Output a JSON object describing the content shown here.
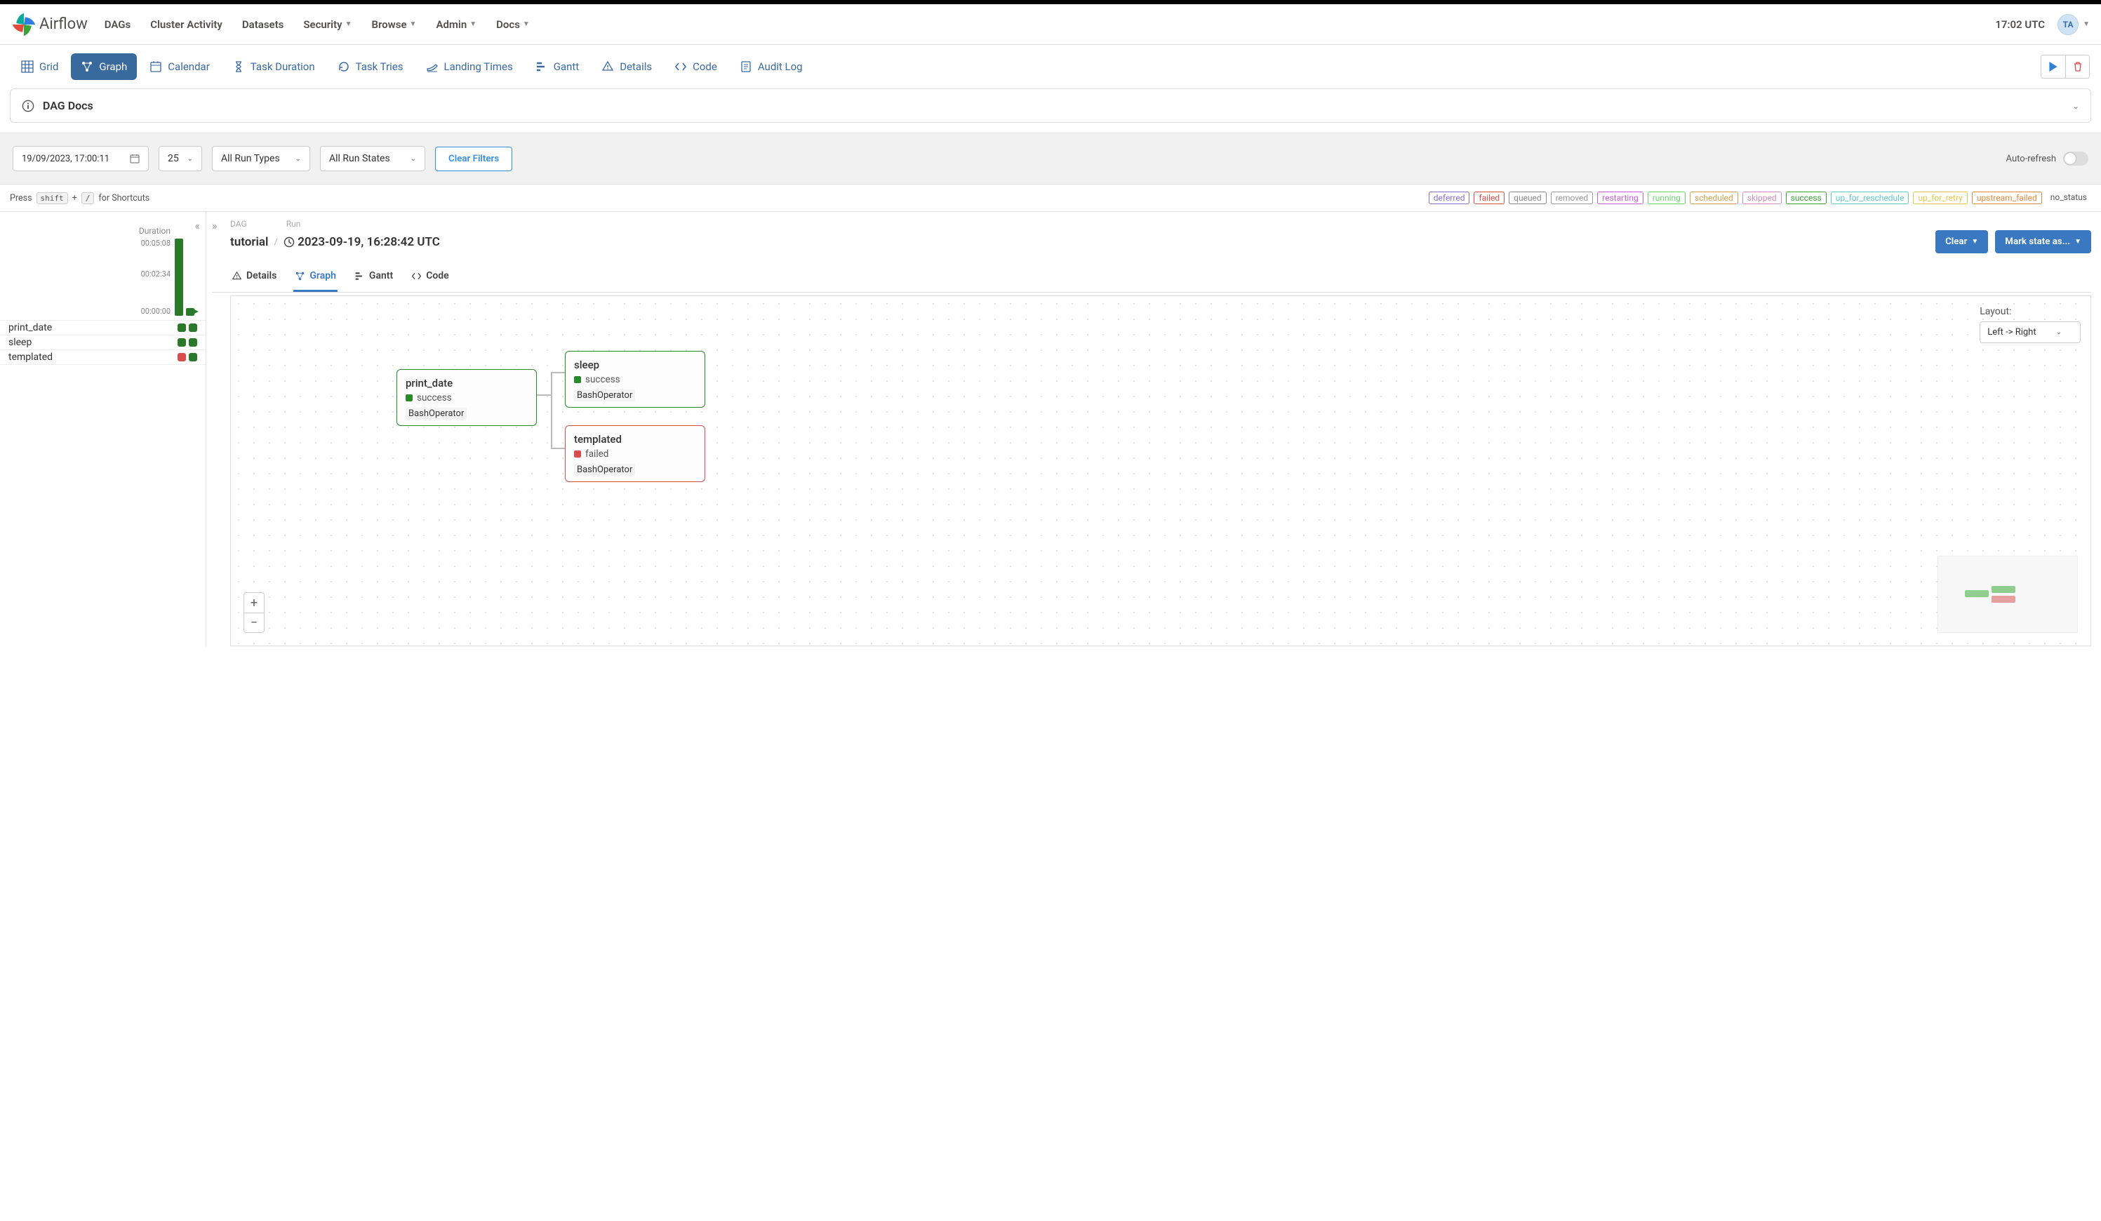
{
  "brand": "Airflow",
  "nav": {
    "items": [
      "DAGs",
      "Cluster Activity",
      "Datasets",
      "Security",
      "Browse",
      "Admin",
      "Docs"
    ],
    "dropdown_flags": [
      false,
      false,
      false,
      true,
      true,
      true,
      true
    ],
    "clock": "17:02 UTC",
    "avatar": "TA"
  },
  "view_tabs": {
    "items": [
      "Grid",
      "Graph",
      "Calendar",
      "Task Duration",
      "Task Tries",
      "Landing Times",
      "Gantt",
      "Details",
      "Code",
      "Audit Log"
    ],
    "active_index": 1
  },
  "dag_docs_label": "DAG Docs",
  "filters": {
    "date": "19/09/2023, 17:00:11",
    "page_size": "25",
    "run_type": "All Run Types",
    "run_state": "All Run States",
    "clear_btn": "Clear Filters",
    "auto_refresh": "Auto-refresh"
  },
  "hint": {
    "press": "Press",
    "shift": "shift",
    "plus": "+",
    "slash": "/",
    "for": "for Shortcuts"
  },
  "status_legend": [
    "deferred",
    "failed",
    "queued",
    "removed",
    "restarting",
    "running",
    "scheduled",
    "skipped",
    "success",
    "up_for_reschedule",
    "up_for_retry",
    "upstream_failed",
    "no_status"
  ],
  "status_colors": {
    "deferred": "#8b6fd0",
    "failed": "#d94d4d",
    "queued": "#888",
    "removed": "#999",
    "restarting": "#c65edb",
    "running": "#6bd46b",
    "scheduled": "#cfa24a",
    "skipped": "#d38bc1",
    "success": "#3aa33a",
    "up_for_reschedule": "#5fc9c6",
    "up_for_retry": "#e0c84b",
    "upstream_failed": "#e08a3c",
    "no_status": "#777"
  },
  "left": {
    "duration_label": "Duration",
    "ticks": [
      "00:05:08",
      "00:02:34",
      "00:00:00"
    ],
    "tasks": [
      {
        "name": "print_date",
        "boxes": [
          "green",
          "green"
        ]
      },
      {
        "name": "sleep",
        "boxes": [
          "green",
          "green"
        ]
      },
      {
        "name": "templated",
        "boxes": [
          "red",
          "green"
        ]
      }
    ]
  },
  "crumb": {
    "dag_h": "DAG",
    "run_h": "Run",
    "dag": "tutorial",
    "run": "2023-09-19, 16:28:42 UTC",
    "btn_clear": "Clear",
    "btn_mark": "Mark state as..."
  },
  "inner_tabs": {
    "items": [
      "Details",
      "Graph",
      "Gantt",
      "Code"
    ],
    "active_index": 1
  },
  "layout": {
    "label": "Layout:",
    "value": "Left -> Right"
  },
  "graph_nodes": [
    {
      "id": "print_date",
      "title": "print_date",
      "status": "success",
      "op": "BashOperator",
      "color": "green"
    },
    {
      "id": "sleep",
      "title": "sleep",
      "status": "success",
      "op": "BashOperator",
      "color": "green"
    },
    {
      "id": "templated",
      "title": "templated",
      "status": "failed",
      "op": "BashOperator",
      "color": "red"
    }
  ]
}
